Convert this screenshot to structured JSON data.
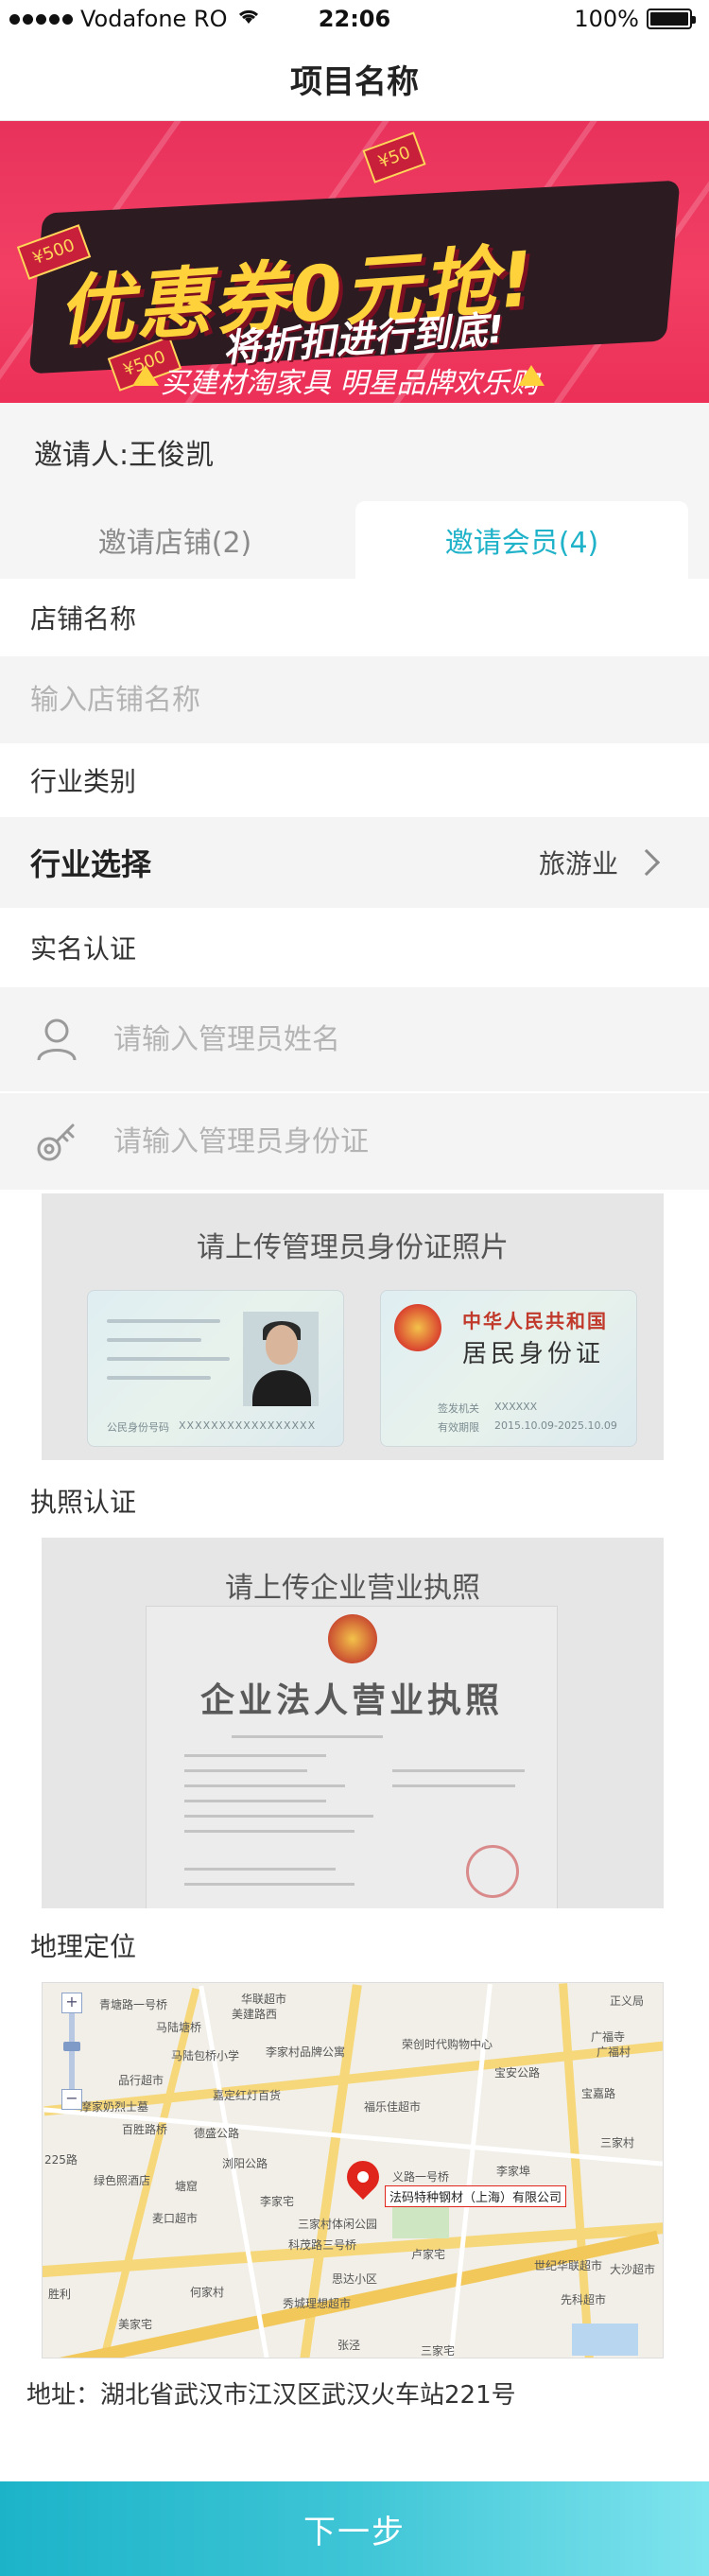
{
  "status_bar": {
    "carrier": "Vodafone RO",
    "time": "22:06",
    "battery": "100%",
    "battery_level": 1.0
  },
  "nav": {
    "title": "项目名称"
  },
  "banner": {
    "headline": "优惠券0元抢!",
    "subline": "将折扣进行到底!",
    "tagline": "买建材淘家具 明星品牌欢乐购",
    "tags": [
      "¥500",
      "¥50",
      "¥500"
    ]
  },
  "inviter": {
    "label": "邀请人:",
    "name": "王俊凯"
  },
  "tabs": [
    {
      "label": "邀请店铺(2)",
      "active": false
    },
    {
      "label": "邀请会员(4)",
      "active": true
    }
  ],
  "store": {
    "section": "店铺名称",
    "placeholder": "输入店铺名称"
  },
  "industry": {
    "section": "行业类别",
    "label": "行业选择",
    "value": "旅游业"
  },
  "realname": {
    "section": "实名认证",
    "name_placeholder": "请输入管理员姓名",
    "id_placeholder": "请输入管理员身份证",
    "upload_title": "请上传管理员身份证照片",
    "card_front_number_label": "公民身份号码",
    "card_front_number": "XXXXXXXXXXXXXXXXX",
    "card_back_title": "中华人民共和国",
    "card_back_sub": "居民身份证",
    "card_back_issuer_label": "签发机关",
    "card_back_issuer": "XXXXXX",
    "card_back_validity_label": "有效期限",
    "card_back_validity": "2015.10.09-2025.10.09"
  },
  "license": {
    "section": "执照认证",
    "upload_title": "请上传企业营业执照",
    "doc_title": "企业法人营业执照"
  },
  "location": {
    "section": "地理定位",
    "pin_label": "法码特种钢材（上海）有限公司",
    "address": "地址：湖北省武汉市江汉区武汉火车站221号",
    "pois": [
      "华联超市",
      "美建路西",
      "青塘路一号桥",
      "马陆塘桥",
      "马陆包桥小学",
      "李家村品牌公寓",
      "荣创时代购物中心",
      "广福寺",
      "广福村",
      "正义局",
      "宝安公路",
      "品行超市",
      "嘉定红灯百货",
      "福乐佳超市",
      "摩家奶烈士墓",
      "百胜路桥",
      "德盛公路",
      "宝嘉路",
      "225路",
      "绿色照酒店",
      "塘窟",
      "浏阳公路",
      "三家村",
      "李家宅",
      "义路一号桥",
      "麦口超市",
      "李家埠",
      "三家村体闲公园",
      "科茂路三号桥",
      "卢家宅",
      "世纪华联超市",
      "大沙超市",
      "何家村",
      "秀城理想超市",
      "思达小区",
      "先科超市",
      "美家宅",
      "张泾",
      "三家宅",
      "胜利"
    ]
  },
  "actions": {
    "next_label": "下一步"
  }
}
